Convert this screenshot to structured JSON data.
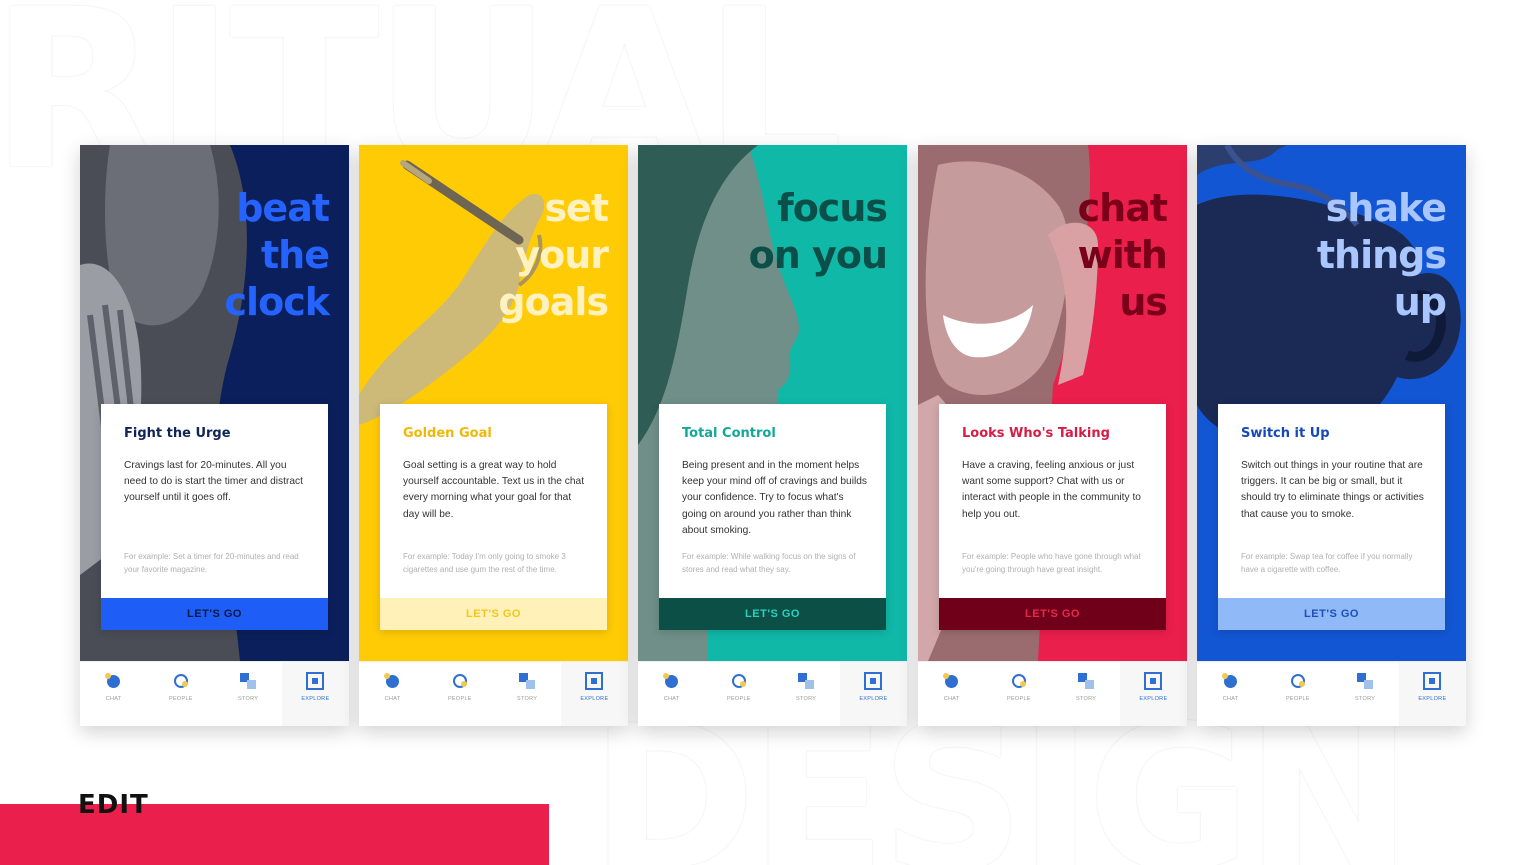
{
  "background": {
    "top_word": "RITUAL",
    "bottom_word": "DESIGN"
  },
  "brand": {
    "logo_text": "EDIT",
    "accent_bar_color": "#ea1f4b"
  },
  "tabs": [
    "CHAT",
    "PEOPLE",
    "STORY",
    "EXPLORE"
  ],
  "screens": [
    {
      "headline": [
        "beat",
        "the",
        "clock"
      ],
      "card": {
        "title": "Fight the Urge",
        "body": "Cravings last for 20-minutes. All you need to do is start the timer and distract yourself until it goes off.",
        "example": "For example: Set a timer for 20-minutes and read your favorite magazine.",
        "cta": "LET'S GO"
      },
      "colors": {
        "bg": "#0b1f5c",
        "headline": "#2563ff",
        "title": "#0f2557",
        "cta_bg": "#1e5ef7",
        "cta_text": "#0a1a45"
      },
      "active_tab": "EXPLORE"
    },
    {
      "headline": [
        "set",
        "your",
        "goals"
      ],
      "card": {
        "title": "Golden Goal",
        "body": "Goal setting is a great way to hold yourself accountable. Text us in the chat every morning what your goal for that day will be.",
        "example": "For example: Today I'm only going to smoke 3 cigarettes and use gum the rest of the time.",
        "cta": "LET'S GO"
      },
      "colors": {
        "bg": "#ffcb05",
        "headline": "#fff1c0",
        "title": "#f2b705",
        "cta_bg": "#fff1b8",
        "cta_text": "#f5c518"
      },
      "active_tab": "EXPLORE"
    },
    {
      "headline": [
        "focus",
        "on you"
      ],
      "card": {
        "title": "Total Control",
        "body": "Being present and in the moment helps keep your mind off of cravings and builds your confidence. Try to focus what's going on around you rather than think about smoking.",
        "example": "For example: While walking focus on the signs of stores and read what they say.",
        "cta": "LET'S GO"
      },
      "colors": {
        "bg": "#10b8a8",
        "headline": "#0b4f48",
        "title": "#11a89a",
        "cta_bg": "#0c4f47",
        "cta_text": "#2ad1bf"
      },
      "active_tab": "EXPLORE"
    },
    {
      "headline": [
        "chat",
        "with",
        "us"
      ],
      "card": {
        "title": "Looks Who's Talking",
        "body": "Have a craving, feeling anxious or just want some support? Chat with us or interact with people in the community to help you out.",
        "example": "For example: People who have gone through what you're going through have great insight.",
        "cta": "LET'S GO"
      },
      "colors": {
        "bg": "#ea1f4b",
        "headline": "#7a0019",
        "title": "#d61c45",
        "cta_bg": "#70001a",
        "cta_text": "#e8294f"
      },
      "active_tab": "EXPLORE"
    },
    {
      "headline": [
        "shake",
        "things",
        "up"
      ],
      "card": {
        "title": "Switch it Up",
        "body": "Switch out things in your routine that are triggers. It can be big or small, but it should try to eliminate things or activities that cause you to smoke.",
        "example": "For example: Swap tea for coffee if you normally have a cigarette with coffee.",
        "cta": "LET'S GO"
      },
      "colors": {
        "bg": "#1356d3",
        "headline": "#a9c6ff",
        "title": "#1548b8",
        "cta_bg": "#8fb9f7",
        "cta_text": "#1d4fb7"
      },
      "active_tab": "EXPLORE"
    }
  ]
}
